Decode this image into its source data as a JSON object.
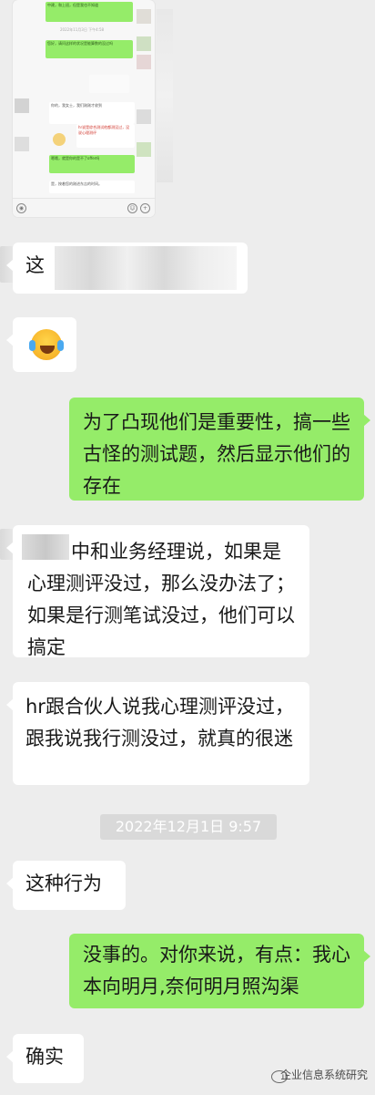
{
  "image_message": {
    "lines": [
      "中建，和上班，但是我也不知道",
      "2022年11月3日 下午4:58",
      "您好，请问这样的状况是能算数的没过吗",
      "你的，我女士，我们刚刚才收到",
      "hr说是综合测试他都测没过，没说心理测评",
      "嗯哦，就是你的是不了offer吗",
      "是，按着您的刚进东吉的时间。"
    ]
  },
  "messages": [
    {
      "side": "left",
      "text": "这"
    },
    {
      "side": "left",
      "emoji": "crying-laughing"
    },
    {
      "side": "right",
      "text": "为了凸现他们是重要性，搞一些古怪的测试题，然后显示他们的存在"
    },
    {
      "side": "left",
      "text": "中和业务经理说，如果是心理测评没过，那么没办法了；如果是行测笔试没过，他们可以搞定"
    },
    {
      "side": "left",
      "text": "hr跟合伙人说我心理测评没过，跟我说我行测没过，就真的很迷"
    },
    {
      "side": "left",
      "text": "这种行为"
    },
    {
      "side": "right",
      "text": "没事的。对你来说，有点：我心本向明月,奈何明月照沟渠"
    },
    {
      "side": "left",
      "text": "确实"
    }
  ],
  "timestamp": "2022年12月1日 9:57",
  "watermark": "企业信息系统研究"
}
